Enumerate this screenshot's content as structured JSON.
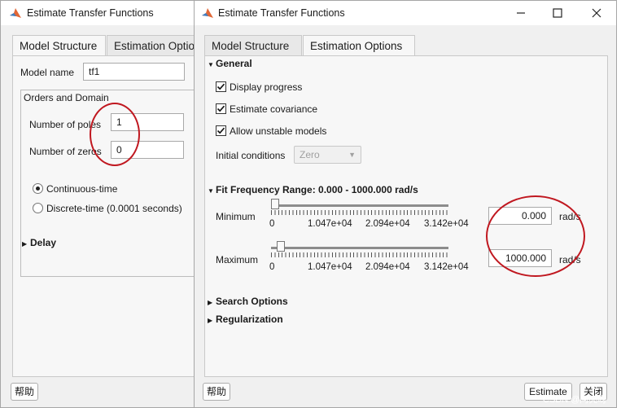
{
  "left_window": {
    "title": "Estimate Transfer Functions",
    "tabs": [
      {
        "label": "Model Structure",
        "active": true
      },
      {
        "label": "Estimation Optio",
        "active": false
      }
    ],
    "model_name_label": "Model name",
    "model_name_value": "tf1",
    "orders_group_title": "Orders and Domain",
    "poles_label": "Number of poles",
    "poles_value": "1",
    "zeros_label": "Number of zeros",
    "zeros_value": "0",
    "continuous_label": "Continuous-time",
    "discrete_label": "Discrete-time (0.0001 seconds)",
    "delay_label": "Delay",
    "help_button": "帮助"
  },
  "right_window": {
    "title": "Estimate Transfer Functions",
    "tabs": [
      {
        "label": "Model Structure",
        "active": false
      },
      {
        "label": "Estimation Options",
        "active": true
      }
    ],
    "general_label": "General",
    "display_progress": "Display progress",
    "estimate_covariance": "Estimate covariance",
    "allow_unstable": "Allow unstable models",
    "initial_conditions_label": "Initial conditions",
    "initial_conditions_value": "Zero",
    "fit_freq_label": "Fit Frequency Range: 0.000 - 1000.000 rad/s",
    "minimum_label": "Minimum",
    "maximum_label": "Maximum",
    "tick_labels": [
      "0",
      "1.047e+04",
      "2.094e+04",
      "3.142e+04"
    ],
    "minimum_value": "0.000",
    "maximum_value": "1000.000",
    "units": "rad/s",
    "search_options_label": "Search Options",
    "regularization_label": "Regularization",
    "help_button": "帮助",
    "estimate_button": "Estimate",
    "close_button": "关闭",
    "minimum_slider_fraction": 0.0,
    "maximum_slider_fraction": 0.0318
  },
  "watermark": "CSDN @阿亮呀",
  "colors": {
    "annotation_red": "#c01820",
    "window_bg": "#f0f0f0",
    "panel_bg": "#f7f7f7"
  },
  "icons": [
    "matlab-icon",
    "minimize-icon",
    "maximize-icon",
    "close-icon",
    "caret-down-icon",
    "caret-right-icon"
  ]
}
